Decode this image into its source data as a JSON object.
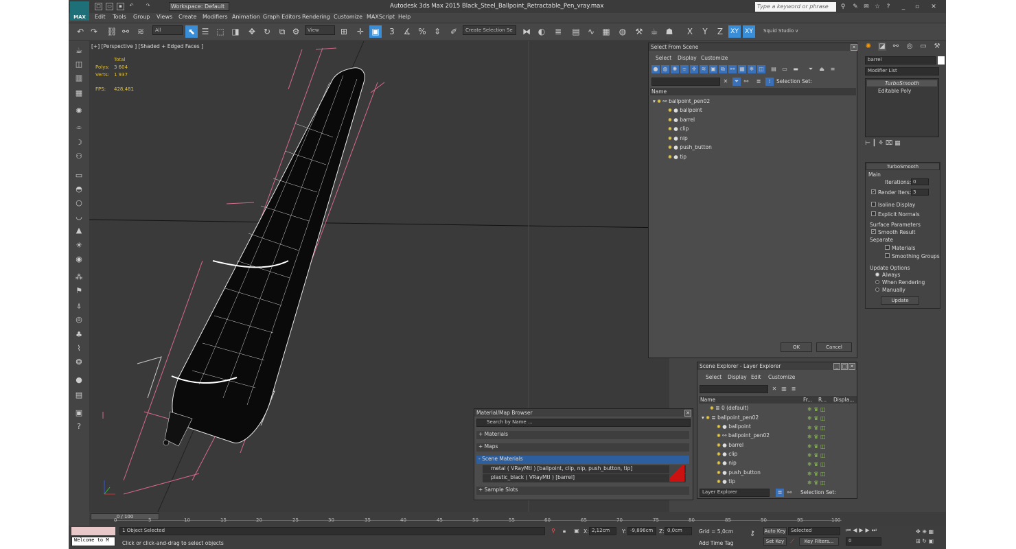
{
  "titlebar": {
    "workspace": "Workspace: Default",
    "title": "Autodesk 3ds Max  2015    Black_Steel_Ballpoint_Retractable_Pen_vray.max",
    "search_placeholder": "Type a keyword or phrase",
    "logo": "MAX"
  },
  "menu": [
    "Edit",
    "Tools",
    "Group",
    "Views",
    "Create",
    "Modifiers",
    "Animation",
    "Graph Editors",
    "Rendering",
    "Customize",
    "MAXScript",
    "Help"
  ],
  "toolbar": {
    "filter": "All",
    "refcoord": "View",
    "selection_set": "Create Selection Se",
    "snap_num": "3",
    "studio": "Squid Studio v",
    "x": "X",
    "y": "Y",
    "z": "Z",
    "xy": "XY",
    "xy2": "XY"
  },
  "viewport": {
    "label": "[+] [Perspective ] [Shaded + Edged Faces ]",
    "stats": {
      "total": "Total",
      "polys_label": "Polys:",
      "polys": "3 604",
      "verts_label": "Verts:",
      "verts": "1 937",
      "fps_label": "FPS:",
      "fps": "428,481"
    }
  },
  "select_from_scene": {
    "title": "Select From Scene",
    "menu": [
      "Select",
      "Display",
      "Customize"
    ],
    "selection_set_label": "Selection Set:",
    "col_name": "Name",
    "tree": [
      "ballpoint_pen02",
      "ballpoint",
      "barrel",
      "clip",
      "nip",
      "push_button",
      "tip"
    ],
    "ok": "OK",
    "cancel": "Cancel"
  },
  "scene_explorer": {
    "title": "Scene Explorer - Layer Explorer",
    "menu": [
      "Select",
      "Display",
      "Edit",
      "Customize"
    ],
    "cols": [
      "Name",
      "Fr...",
      "R...",
      "Displa..."
    ],
    "rows": [
      "0 (default)",
      "ballpoint_pen02",
      "ballpoint",
      "ballpoint_pen02",
      "barrel",
      "clip",
      "nip",
      "push_button",
      "tip"
    ],
    "footer_left": "Layer Explorer",
    "footer_right": "Selection Set:"
  },
  "material_browser": {
    "title": "Material/Map Browser",
    "search": "Search by Name ...",
    "sections": [
      "+ Materials",
      "+ Maps",
      "- Scene Materials",
      "+ Sample Slots"
    ],
    "materials": [
      "metal  ( VRayMtl ) [ballpoint, clip, nip, push_button, tip]",
      "plastic_black  ( VRayMtl ) [barrel]"
    ]
  },
  "command_panel": {
    "object_name": "barrel",
    "modifier_list": "Modifier List",
    "stack": [
      "TurboSmooth",
      "Editable Poly"
    ],
    "rollout": "TurboSmooth",
    "main": "Main",
    "iterations_label": "Iterations:",
    "iterations": "0",
    "render_iters_label": "Render Iters:",
    "render_iters": "3",
    "isoline": "Isoline Display",
    "explicit": "Explicit Normals",
    "surface_params": "Surface Parameters",
    "smooth_result": "Smooth Result",
    "separate": "Separate",
    "materials": "Materials",
    "smoothing_groups": "Smoothing Groups",
    "update_options": "Update Options",
    "always": "Always",
    "when_rendering": "When Rendering",
    "manually": "Manually",
    "update": "Update"
  },
  "timeline": {
    "frame": "0 / 100",
    "ticks": [
      "0",
      "5",
      "10",
      "15",
      "20",
      "25",
      "30",
      "35",
      "40",
      "45",
      "50",
      "55",
      "60",
      "65",
      "70",
      "75",
      "80",
      "85",
      "90",
      "95",
      "100"
    ]
  },
  "status": {
    "welcome": "Welcome to M",
    "selected": "1 Object Selected",
    "prompt": "Click or click-and-drag to select objects",
    "x_label": "X:",
    "x": "2,12cm",
    "y_label": "Y:",
    "y": "-9,896cm",
    "z_label": "Z:",
    "z": "0,0cm",
    "grid": "Grid = 5,0cm",
    "add_time_tag": "Add Time Tag",
    "auto_key": "Auto Key",
    "set_key": "Set Key",
    "selected_dd": "Selected",
    "key_filters": "Key Filters...",
    "frame_field": "0"
  },
  "colors": {
    "accent": "#3a8ed8",
    "selection_highlight": "#2d5f9e",
    "bulb": "#f0d040",
    "material_swatch": "#cc1111"
  }
}
